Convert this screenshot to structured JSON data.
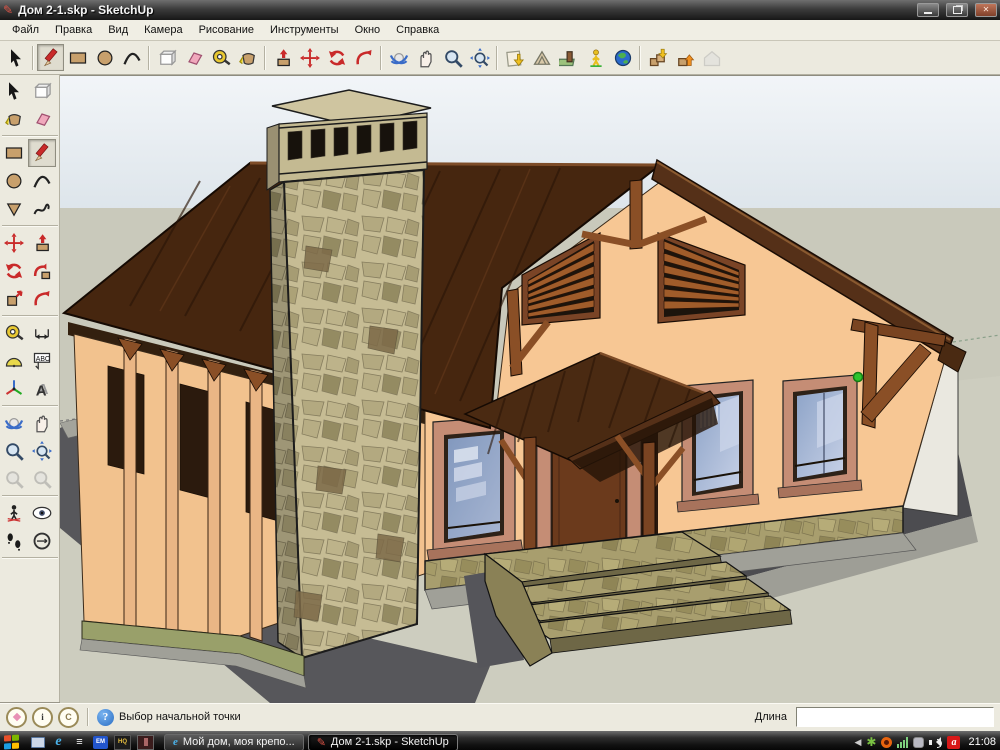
{
  "titlebar": {
    "title": "Дом 2-1.skp - SketchUp",
    "icon": "sketchup-pencil-icon",
    "controls": [
      "minimize",
      "restore",
      "close"
    ]
  },
  "menu": {
    "items": [
      "Файл",
      "Правка",
      "Вид",
      "Камера",
      "Рисование",
      "Инструменты",
      "Окно",
      "Справка"
    ]
  },
  "toolbar": {
    "active_tool": "line",
    "groups": [
      [
        "select"
      ],
      [
        "line",
        "rectangle",
        "circle",
        "arc"
      ],
      [
        "make-component",
        "eraser",
        "tape-measure",
        "paint-bucket"
      ],
      [
        "push-pull",
        "move",
        "rotate",
        "offset"
      ],
      [
        "orbit",
        "pan",
        "zoom",
        "zoom-extents"
      ],
      [
        "get-current-view",
        "toggle-terrain",
        "place-model",
        "add-building",
        "google-earth"
      ],
      [
        "get-models",
        "share-model",
        "share-component-disabled"
      ]
    ]
  },
  "palette": {
    "groups": [
      [
        "select",
        "make-component"
      ],
      [
        "paint-bucket",
        "eraser"
      ],
      [
        "rectangle",
        "line"
      ],
      [
        "circle",
        "arc"
      ],
      [
        "polygon",
        "freehand"
      ],
      [
        "move",
        "push-pull"
      ],
      [
        "rotate",
        "follow-me"
      ],
      [
        "scale",
        "offset"
      ],
      [
        "tape-measure",
        "dimension"
      ],
      [
        "protractor",
        "text"
      ],
      [
        "axes",
        "3d-text"
      ],
      [
        "orbit",
        "pan"
      ],
      [
        "zoom",
        "zoom-extents"
      ],
      [
        "zoom-previous-disabled",
        "zoom-next-disabled"
      ],
      [
        "position-camera",
        "look-around"
      ],
      [
        "walk",
        "section-plane"
      ]
    ]
  },
  "statusbar": {
    "badges": [
      "geo-badge",
      "author-badge",
      "credit-badge"
    ],
    "hint": "Выбор начальной точки",
    "vcb_label": "Длина",
    "vcb_value": ""
  },
  "taskbar": {
    "quick_launch": [
      "show-desktop",
      "internet-explorer",
      "app-menu",
      "em-app",
      "hq-app",
      "dark-app"
    ],
    "tasks": [
      {
        "icon": "internet-explorer",
        "label": "Мой дом, моя крепо...",
        "active": false
      },
      {
        "icon": "sketchup-pencil",
        "label": "Дом 2-1.skp - SketchUp",
        "active": true
      }
    ],
    "tray_icons": [
      "collapse-arrow",
      "icq",
      "download-manager",
      "network-signal",
      "messenger",
      "volume",
      "avira"
    ],
    "clock": "21:08"
  },
  "viewport": {
    "inference_marker_color": "#2ec42e"
  },
  "colors": {
    "titlebar": "#2e2e2e",
    "chrome": "#eceadf",
    "sky_top": "#f2f5f8",
    "sky_bottom": "#dce4ea",
    "ground": "#c9c9bb",
    "wall": "#f7c794",
    "roof": "#4a2a12",
    "timber": "#8a4f26",
    "window_frame": "#c58d75",
    "glass": "#9fb2d4",
    "stone": "#c6bc94",
    "steps": "#a89e6e",
    "driveway": "#57575b",
    "inference_point": "#2ec42e"
  }
}
